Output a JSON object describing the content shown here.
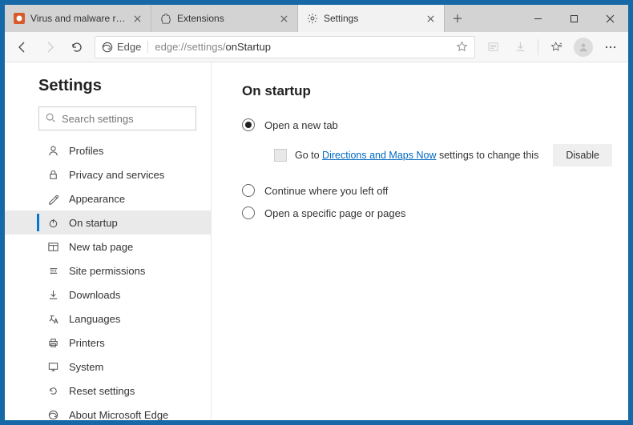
{
  "tabs": [
    {
      "title": "Virus and malware removal instructions"
    },
    {
      "title": "Extensions"
    },
    {
      "title": "Settings"
    }
  ],
  "address": {
    "badge": "Edge",
    "prefix": "edge://settings/",
    "path": "onStartup"
  },
  "sidebar": {
    "title": "Settings",
    "search_placeholder": "Search settings",
    "items": [
      {
        "label": "Profiles"
      },
      {
        "label": "Privacy and services"
      },
      {
        "label": "Appearance"
      },
      {
        "label": "On startup"
      },
      {
        "label": "New tab page"
      },
      {
        "label": "Site permissions"
      },
      {
        "label": "Downloads"
      },
      {
        "label": "Languages"
      },
      {
        "label": "Printers"
      },
      {
        "label": "System"
      },
      {
        "label": "Reset settings"
      },
      {
        "label": "About Microsoft Edge"
      }
    ]
  },
  "main": {
    "heading": "On startup",
    "options": [
      {
        "label": "Open a new tab"
      },
      {
        "label": "Continue where you left off"
      },
      {
        "label": "Open a specific page or pages"
      }
    ],
    "extension_notice": {
      "prefix": "Go to ",
      "link": "Directions and Maps Now",
      "suffix": " settings to change this",
      "button": "Disable"
    }
  }
}
